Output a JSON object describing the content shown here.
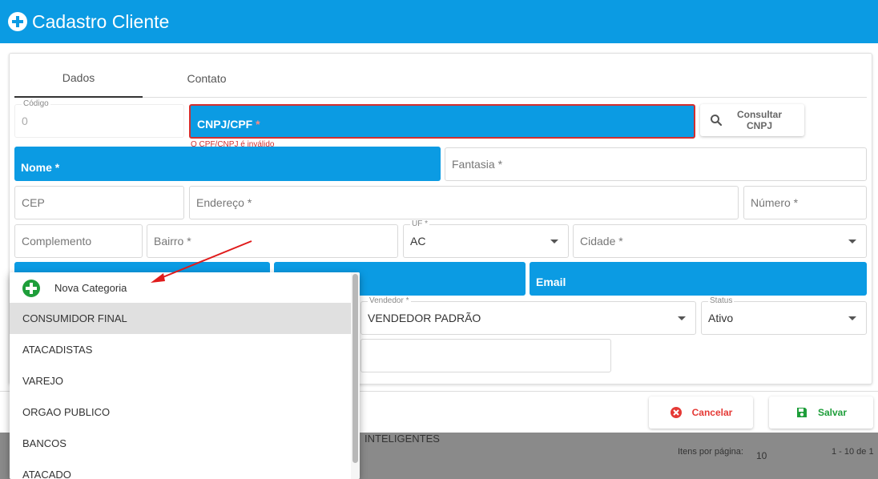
{
  "header": {
    "title": "Cadastro Cliente"
  },
  "tabs": [
    {
      "label": "Dados"
    },
    {
      "label": "Contato"
    }
  ],
  "fields": {
    "codigo": {
      "label": "Código",
      "value": "0"
    },
    "cnpj": {
      "label": "CNPJ/CPF",
      "error": "O CPF/CNPJ é inválido"
    },
    "consultar": {
      "label_line1": "Consultar",
      "label_line2": "CNPJ"
    },
    "nome": {
      "label": "Nome"
    },
    "fantasia": {
      "label": "Fantasia *"
    },
    "cep": {
      "label": "CEP"
    },
    "endereco": {
      "label": "Endereço *"
    },
    "numero": {
      "label": "Número *"
    },
    "complemento": {
      "label": "Complemento"
    },
    "bairro": {
      "label": "Bairro *"
    },
    "uf": {
      "label": "UF *",
      "value": "AC"
    },
    "cidade": {
      "label": "Cidade *"
    },
    "email": {
      "label": "Email"
    },
    "vendedor": {
      "label": "Vendedor *",
      "value": "VENDEDOR PADRÃO"
    },
    "status": {
      "label": "Status",
      "value": "Ativo"
    }
  },
  "required_mark": "*",
  "buttons": {
    "cancel": "Cancelar",
    "save": "Salvar"
  },
  "dropdown": {
    "new_label": "Nova Categoria",
    "items": [
      "CONSUMIDOR FINAL",
      "ATACADISTAS",
      "VAREJO",
      "ORGAO PUBLICO",
      "BANCOS",
      "ATACADO"
    ]
  },
  "background": {
    "row_text": "INTELIGENTES",
    "items_per_page_label": "Itens por página:",
    "items_per_page_value": "10",
    "range_text": "1 - 10 de 1"
  },
  "colors": {
    "primary": "#0b9be3",
    "error": "#d32f2f",
    "success": "#1e9e3a",
    "cancel": "#e53935"
  }
}
